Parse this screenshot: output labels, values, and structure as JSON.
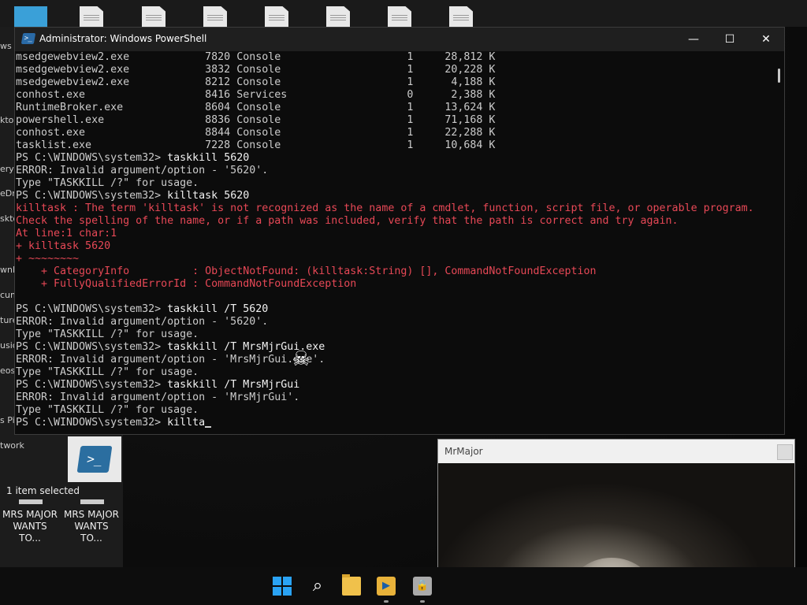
{
  "powershell": {
    "title": "Administrator: Windows PowerShell",
    "lines": [
      {
        "text": "msedgewebview2.exe            7820 Console                    1     28,812 K",
        "type": "out"
      },
      {
        "text": "msedgewebview2.exe            3832 Console                    1     20,228 K",
        "type": "out"
      },
      {
        "text": "msedgewebview2.exe            8212 Console                    1      4,188 K",
        "type": "out"
      },
      {
        "text": "conhost.exe                   8416 Services                   0      2,388 K",
        "type": "out"
      },
      {
        "text": "RuntimeBroker.exe             8604 Console                    1     13,624 K",
        "type": "out"
      },
      {
        "text": "powershell.exe                8836 Console                    1     71,168 K",
        "type": "out"
      },
      {
        "text": "conhost.exe                   8844 Console                    1     22,288 K",
        "type": "out"
      },
      {
        "text": "tasklist.exe                  7228 Console                    1     10,684 K",
        "type": "out"
      },
      {
        "text": "PS C:\\WINDOWS\\system32> ",
        "cmd": "taskkill 5620",
        "type": "prompt"
      },
      {
        "text": "ERROR: Invalid argument/option - '5620'.",
        "type": "out"
      },
      {
        "text": "Type \"TASKKILL /?\" for usage.",
        "type": "out"
      },
      {
        "text": "PS C:\\WINDOWS\\system32> ",
        "cmd": "killtask 5620",
        "type": "prompt"
      },
      {
        "text": "killtask : The term 'killtask' is not recognized as the name of a cmdlet, function, script file, or operable program.",
        "type": "err"
      },
      {
        "text": "Check the spelling of the name, or if a path was included, verify that the path is correct and try again.",
        "type": "err"
      },
      {
        "text": "At line:1 char:1",
        "type": "err"
      },
      {
        "text": "+ killtask 5620",
        "type": "err"
      },
      {
        "text": "+ ~~~~~~~~",
        "type": "err"
      },
      {
        "text": "    + CategoryInfo          : ObjectNotFound: (killtask:String) [], CommandNotFoundException",
        "type": "err"
      },
      {
        "text": "    + FullyQualifiedErrorId : CommandNotFoundException",
        "type": "err"
      },
      {
        "text": "",
        "type": "out"
      },
      {
        "text": "PS C:\\WINDOWS\\system32> ",
        "cmd": "taskkill /T 5620",
        "type": "prompt"
      },
      {
        "text": "ERROR: Invalid argument/option - '5620'.",
        "type": "out"
      },
      {
        "text": "Type \"TASKKILL /?\" for usage.",
        "type": "out"
      },
      {
        "text": "PS C:\\WINDOWS\\system32> ",
        "cmd": "taskkill /T MrsMjrGui.exe",
        "type": "prompt"
      },
      {
        "text": "ERROR: Invalid argument/option - 'MrsMjrGui.exe'.",
        "type": "out"
      },
      {
        "text": "Type \"TASKKILL /?\" for usage.",
        "type": "out"
      },
      {
        "text": "PS C:\\WINDOWS\\system32> ",
        "cmd": "taskkill /T MrsMjrGui",
        "type": "prompt"
      },
      {
        "text": "ERROR: Invalid argument/option - 'MrsMjrGui'.",
        "type": "out"
      },
      {
        "text": "Type \"TASKKILL /?\" for usage.",
        "type": "out"
      },
      {
        "text": "PS C:\\WINDOWS\\system32> ",
        "cmd": "killta",
        "type": "prompt-active"
      }
    ],
    "buttons": {
      "minimize": "—",
      "maximize": "☐",
      "close": "✕"
    }
  },
  "explorer": {
    "fragments": [
      "ws To",
      "ktop",
      "ery",
      "eDri",
      "skto",
      "wnl",
      "cum",
      "ture",
      "usic",
      "eos",
      "s Pi",
      "twork"
    ],
    "selection_status": "1 item selected",
    "files": [
      "MRS MAJOR WANTS TO...",
      "MRS MAJOR WANTS TO..."
    ]
  },
  "mrmajor": {
    "title": "MrMajor"
  },
  "cursor_glyph": "☠",
  "taskbar": {
    "icons": [
      "start-icon",
      "search-icon",
      "file-explorer-icon",
      "media-player-icon",
      "security-app-icon"
    ]
  }
}
